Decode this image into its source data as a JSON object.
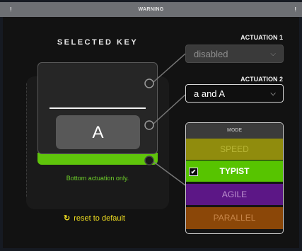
{
  "window": {
    "title": "WARNING",
    "left_mark": "!",
    "right_mark": "!"
  },
  "selected_key": {
    "label": "SELECTED KEY",
    "key_char": "A",
    "hint": "Bottom actuation only.",
    "reset_label": "reset to default"
  },
  "actuation1": {
    "label": "ACTUATION 1",
    "value": "disabled"
  },
  "actuation2": {
    "label": "ACTUATION 2",
    "value": "a and A"
  },
  "mode": {
    "title": "MODE",
    "options": [
      {
        "label": "SPEED",
        "selected": false
      },
      {
        "label": "TYPIST",
        "selected": true
      },
      {
        "label": "AGILE",
        "selected": false
      },
      {
        "label": "PARALLEL",
        "selected": false
      }
    ]
  },
  "colors": {
    "accent_green": "#5fc40b",
    "reset_yellow": "#f0de21",
    "speed": "#908c0d",
    "typist": "#57c400",
    "agile": "#5c1786",
    "parallel": "#8b4708"
  }
}
